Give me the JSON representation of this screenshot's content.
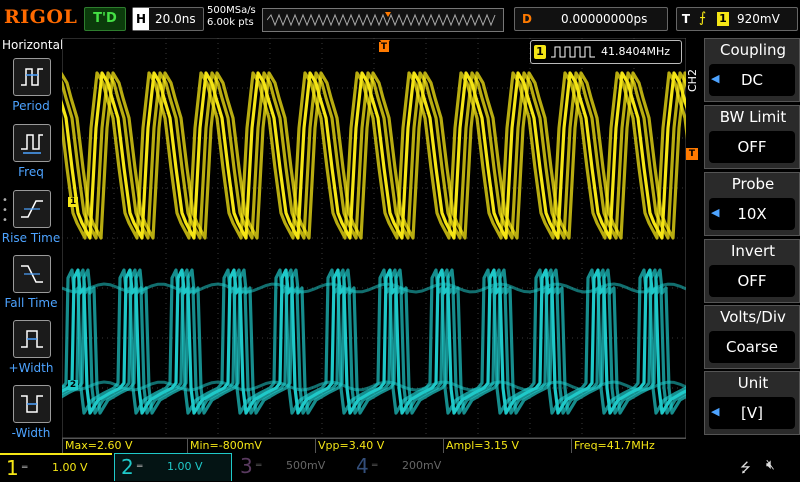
{
  "topbar": {
    "logo": "RIGOL",
    "trigger_status": "T'D",
    "horizontal_key": "H",
    "timebase": "20.0ns",
    "sample_rate": "500MSa/s",
    "memory_depth": "6.00k pts",
    "delay_key": "D",
    "delay_value": "0.00000000ps",
    "trigger_key": "T",
    "trigger_source": "1",
    "trigger_level": "920mV"
  },
  "left_panel": {
    "title": "Horizontal",
    "items": [
      {
        "label": "Period",
        "icon": "period-icon"
      },
      {
        "label": "Freq",
        "icon": "freq-icon"
      },
      {
        "label": "Rise Time",
        "icon": "rise-time-icon"
      },
      {
        "label": "Fall Time",
        "icon": "fall-time-icon"
      },
      {
        "label": "+Width",
        "icon": "pos-width-icon"
      },
      {
        "label": "-Width",
        "icon": "neg-width-icon"
      }
    ]
  },
  "screen": {
    "freq_counter_channel": "1",
    "freq_counter_value": "41.8404MHz",
    "ch1_marker": "1",
    "ch2_marker": "2",
    "trigger_marker": "T",
    "ch1_color": "#f5e616",
    "ch2_color": "#1fc9c9"
  },
  "measurements": [
    {
      "label": "Max=2.60 V"
    },
    {
      "label": "Min=-800mV"
    },
    {
      "label": "Vpp=3.40 V"
    },
    {
      "label": "Ampl=3.15 V"
    },
    {
      "label": "Freq=41.7MHz"
    }
  ],
  "right_menu": {
    "channel_tag": "CH2",
    "trigger_arrow": "T",
    "items": [
      {
        "title": "Coupling",
        "value": "DC"
      },
      {
        "title": "BW Limit",
        "value": "OFF"
      },
      {
        "title": "Probe",
        "value": "10X"
      },
      {
        "title": "Invert",
        "value": "OFF"
      },
      {
        "title": "Volts/Div",
        "value": "Coarse"
      },
      {
        "title": "Unit",
        "value": "[V]"
      }
    ]
  },
  "bottom": {
    "channels": [
      {
        "num": "1",
        "scale": "1.00 V",
        "color": "#f5e616",
        "active": true
      },
      {
        "num": "2",
        "scale": "1.00 V",
        "color": "#1fc9c9",
        "active": true
      },
      {
        "num": "3",
        "scale": "500mV",
        "color": "#b04fbf",
        "active": false
      },
      {
        "num": "4",
        "scale": "200mV",
        "color": "#3a6fd8",
        "active": false
      }
    ],
    "usb_icon": "usb-icon",
    "speaker_icon": "speaker-muted-icon"
  }
}
